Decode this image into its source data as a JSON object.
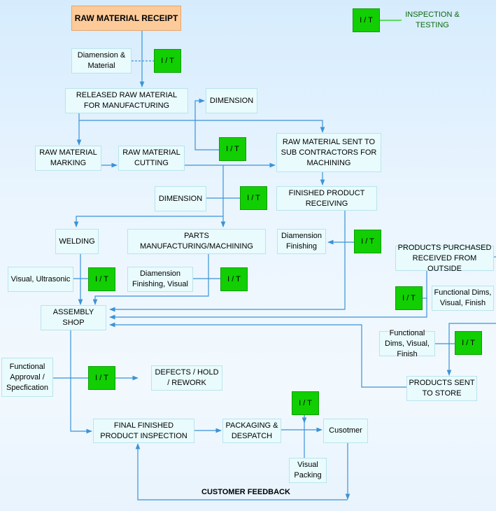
{
  "legend": {
    "badge": "I / T",
    "label_line1": "INSPECTION &",
    "label_line2": "TESTING",
    "color": "#11cf02",
    "text_color": "#0b6a0b"
  },
  "it_label": "I / T",
  "nodes": {
    "raw_material_receipt": "RAW MATERIAL RECEIPT",
    "dimension_material": "Diamension & Material",
    "released_raw_material": "RELEASED RAW MATERIAL FOR MANUFACTURING",
    "dimension_top": "DIMENSION",
    "raw_material_marking": "RAW MATERIAL MARKING",
    "raw_material_cutting": "RAW MATERIAL CUTTING",
    "sent_to_subcontractors": "RAW MATERIAL SENT TO SUB CONTRACTORS FOR MACHINING",
    "dimension_mid": "DIMENSION",
    "finished_product_receiving": "FINISHED PRODUCT RECEIVING",
    "welding": "WELDING",
    "parts_manufacturing": "PARTS MANUFACTURING/MACHINING",
    "dimension_finishing": "Diamension Finishing",
    "products_purchased": "PRODUCTS PURCHASED RECEIVED FROM OUTSIDE",
    "visual_ultrasonic": "Visual, Ultrasonic",
    "dimension_finishing_visual": "Diamension Finishing, Visual",
    "assembly_shop": "ASSEMBLY SHOP",
    "functional_dims_1": "Functional Dims, Visual, Finish",
    "functional_dims_2": "Functional Dims, Visual, Finish",
    "functional_approval": "Functional Approval / Specfication",
    "defects_hold_rework": "DEFECTS / HOLD / REWORK",
    "products_sent_to_store": "PRODUCTS SENT TO STORE",
    "final_inspection": "FINAL FINISHED PRODUCT INSPECTION",
    "packaging_despatch": "PACKAGING & DESPATCH",
    "customer": "Cusotmer",
    "visual_packing": "Visual Packing"
  },
  "customer_feedback": "CUSTOMER FEEDBACK",
  "colors": {
    "connector": "#3a93d6",
    "box_fill": "#e9fbfd",
    "box_border": "#b9e4ec",
    "start_fill": "#fdcb9a"
  }
}
